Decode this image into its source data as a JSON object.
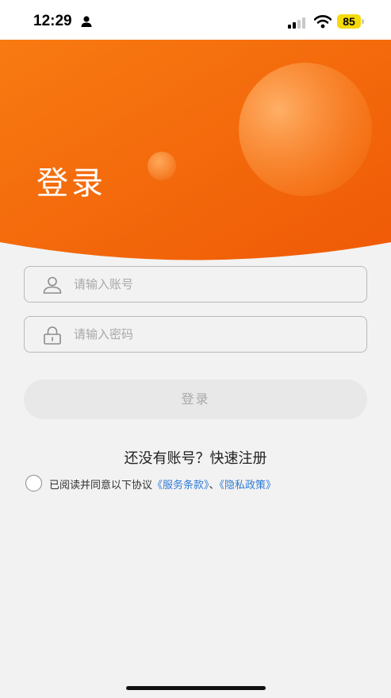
{
  "status_bar": {
    "time": "12:29",
    "battery": "85",
    "icons": [
      "person-icon",
      "signal-icon",
      "wifi-icon",
      "battery-icon"
    ]
  },
  "header": {
    "title": "登录",
    "gradient_start": "#f87a12",
    "gradient_end": "#ef5a06"
  },
  "form": {
    "account": {
      "placeholder": "请输入账号",
      "value": "",
      "icon": "user-icon"
    },
    "password": {
      "placeholder": "请输入密码",
      "value": "",
      "icon": "lock-icon"
    },
    "login_label": "登录"
  },
  "register_text": "还没有账号？快速注册",
  "agreement": {
    "checked": false,
    "prefix": "已阅读并同意以下协议",
    "terms_link": "《服务条款》",
    "separator": "、",
    "privacy_link": "《隐私政策》",
    "link_color": "#2f7bd8"
  }
}
